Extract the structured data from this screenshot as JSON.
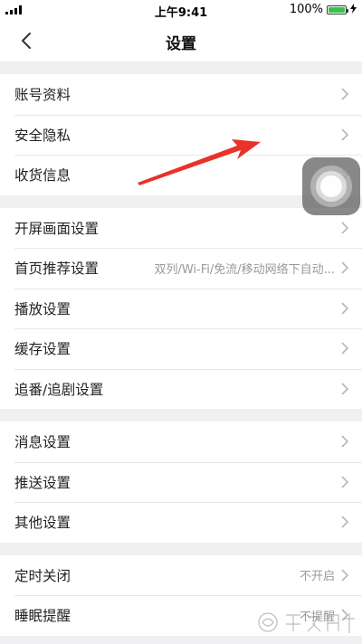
{
  "status_bar": {
    "time": "上午9:41",
    "battery_percent": "100%",
    "battery_level": 1.0,
    "signal_icon": "signal-bars-icon",
    "battery_icon": "battery-icon",
    "charging_icon": "lightning-icon"
  },
  "nav": {
    "title": "设置",
    "back_icon": "chevron-left-icon"
  },
  "groups": [
    {
      "items": [
        {
          "label": "账号资料",
          "value": ""
        },
        {
          "label": "安全隐私",
          "value": ""
        },
        {
          "label": "收货信息",
          "value": ""
        }
      ]
    },
    {
      "items": [
        {
          "label": "开屏画面设置",
          "value": ""
        },
        {
          "label": "首页推荐设置",
          "value": "双列/Wi-Fi/免流/移动网络下自动..."
        },
        {
          "label": "播放设置",
          "value": ""
        },
        {
          "label": "缓存设置",
          "value": ""
        },
        {
          "label": "追番/追剧设置",
          "value": ""
        }
      ]
    },
    {
      "items": [
        {
          "label": "消息设置",
          "value": ""
        },
        {
          "label": "推送设置",
          "value": ""
        },
        {
          "label": "其他设置",
          "value": ""
        }
      ]
    },
    {
      "items": [
        {
          "label": "定时关闭",
          "value": "不开启"
        },
        {
          "label": "睡眠提醒",
          "value": "不提醒"
        }
      ]
    }
  ],
  "overlays": {
    "annotation_arrow_color": "#e8322a",
    "assistive_touch_icon": "assistive-touch-icon",
    "watermark_icon": "baidu-jingyan-watermark"
  },
  "colors": {
    "background": "#f0f0f2",
    "row_background": "#ffffff",
    "value_text": "#999999",
    "chevron": "#b5b5b8",
    "battery_green": "#3ac24a"
  }
}
